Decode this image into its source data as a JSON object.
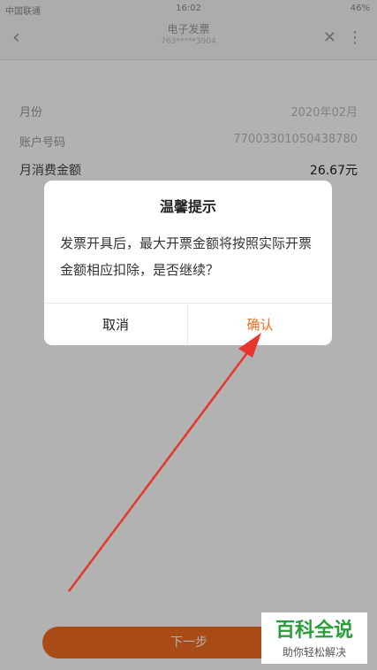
{
  "statusbar": {
    "carrier": "中国联通",
    "time": "16:02",
    "battery": "46%"
  },
  "navbar": {
    "title": "电子发票",
    "subtitle": "763*****3904"
  },
  "rows": [
    {
      "label": "月份",
      "value": "2020年02月"
    },
    {
      "label": "账户号码",
      "value": "77003301050438780"
    },
    {
      "label": "月消费金额",
      "value": "26.67元"
    }
  ],
  "next_button": "下一步",
  "dialog": {
    "title": "温馨提示",
    "message": "发票开具后，最大开票金额将按照实际开票金额相应扣除，是否继续？",
    "cancel": "取消",
    "confirm": "确认"
  },
  "watermark": {
    "title": "百科全说",
    "subtitle": "助你轻松解决"
  },
  "colors": {
    "accent": "#f26c20",
    "annotation_arrow": "#e8352e",
    "watermark": "#2a9e3a"
  }
}
